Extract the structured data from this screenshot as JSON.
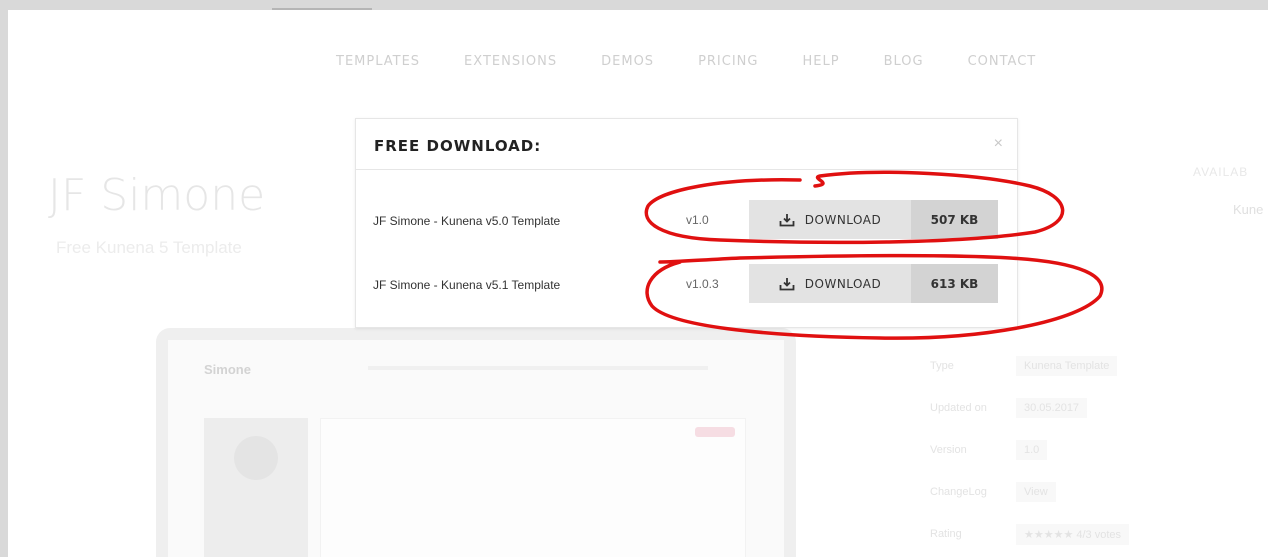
{
  "nav": [
    "TEMPLATES",
    "EXTENSIONS",
    "DEMOS",
    "PRICING",
    "HELP",
    "BLOG",
    "CONTACT"
  ],
  "product": {
    "title": "JF Simone",
    "subtitle": "Free Kunena 5 Template",
    "available_label": "AVAILAB",
    "available_value": "Kune"
  },
  "preview": {
    "brand": "Simone"
  },
  "meta": [
    {
      "key": "Type",
      "value": "Kunena Template"
    },
    {
      "key": "Updated on",
      "value": "30.05.2017"
    },
    {
      "key": "Version",
      "value": "1.0"
    },
    {
      "key": "ChangeLog",
      "value": "View"
    },
    {
      "key": "Rating",
      "value": "★★★★★ 4/3 votes"
    }
  ],
  "modal": {
    "title": "FREE DOWNLOAD:",
    "close": "×",
    "rows": [
      {
        "name": "JF Simone - Kunena v5.0 Template",
        "version": "v1.0",
        "button": "DOWNLOAD",
        "size": "507 KB"
      },
      {
        "name": "JF Simone - Kunena v5.1 Template",
        "version": "v1.0.3",
        "button": "DOWNLOAD",
        "size": "613 KB"
      }
    ]
  },
  "colors": {
    "annotation": "#e01010",
    "button_bg": "#e3e3e3",
    "size_bg": "#d3d3d3"
  },
  "icons": {
    "download": "download-tray-icon"
  }
}
